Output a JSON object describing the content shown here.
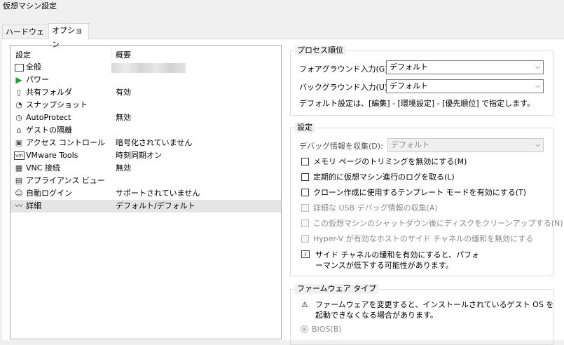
{
  "window": {
    "title": "仮想マシン設定"
  },
  "tabs": [
    {
      "label": "ハードウェア"
    },
    {
      "label": "オプション"
    }
  ],
  "list": {
    "headers": {
      "settings": "設定",
      "summary": "概要"
    },
    "rows": [
      {
        "icon": "monitor-icon",
        "glyph": "▭",
        "name": "全般",
        "value": ""
      },
      {
        "icon": "play-icon",
        "glyph": "▶",
        "name": "パワー",
        "value": ""
      },
      {
        "icon": "shared-folder-icon",
        "glyph": "▯",
        "name": "共有フォルダ",
        "value": "有効"
      },
      {
        "icon": "snapshot-icon",
        "glyph": "◔",
        "name": "スナップショット",
        "value": ""
      },
      {
        "icon": "autoprotect-icon",
        "glyph": "◷",
        "name": "AutoProtect",
        "value": "無効"
      },
      {
        "icon": "guest-isolation-icon",
        "glyph": "⌂",
        "name": "ゲストの隔離",
        "value": ""
      },
      {
        "icon": "access-control-icon",
        "glyph": "▣",
        "name": "アクセス コントロール",
        "value": "暗号化されていません"
      },
      {
        "icon": "vmware-tools-icon",
        "glyph": "vm",
        "name": "VMware Tools",
        "value": "時刻同期オン"
      },
      {
        "icon": "vnc-icon",
        "glyph": "▦",
        "name": "VNC 接続",
        "value": "無効"
      },
      {
        "icon": "appliance-view-icon",
        "glyph": "▤",
        "name": "アプライアンス ビュー",
        "value": ""
      },
      {
        "icon": "autologin-icon",
        "glyph": "☺",
        "name": "自動ログイン",
        "value": "サポートされていません"
      },
      {
        "icon": "advanced-icon",
        "glyph": "〰",
        "name": "詳細",
        "value": "デフォルト/デフォルト"
      }
    ]
  },
  "process_priority": {
    "legend": "プロセス順位",
    "foreground_label": "フォアグラウンド入力(G):",
    "foreground_value": "デフォルト",
    "background_label": "バックグラウンド入力(U):",
    "background_value": "デフォルト",
    "note": "デフォルト設定は、[編集] - [環境設定] - [優先順位] で指定します。"
  },
  "settings": {
    "legend": "設定",
    "debug_label": "デバッグ情報を収集(D):",
    "debug_value": "デフォルト",
    "checkboxes": [
      "メモリ ページのトリミングを無効にする(M)",
      "定期的に仮想マシン進行のログを取る(L)",
      "クローン作成に使用するテンプレート モードを有効にする(T)",
      "詳細な USB デバッグ情報の収集(A)",
      "この仮想マシンのシャットダウン後にディスクをクリーンアップする(N)",
      "Hyper-V が有効なホストのサイド チャネルの緩和を無効にする"
    ],
    "info_line1": "サイド チャネルの緩和を有効にすると、パフォ",
    "info_line2": "ーマンスが低下する可能性があります。"
  },
  "firmware": {
    "legend": "ファームウェア タイプ",
    "warning_line1": "ファームウェアを変更すると、インストールされているゲスト OS を",
    "warning_line2": "起動できなくなる場合があります。",
    "bios_label": "BIOS(B)"
  }
}
